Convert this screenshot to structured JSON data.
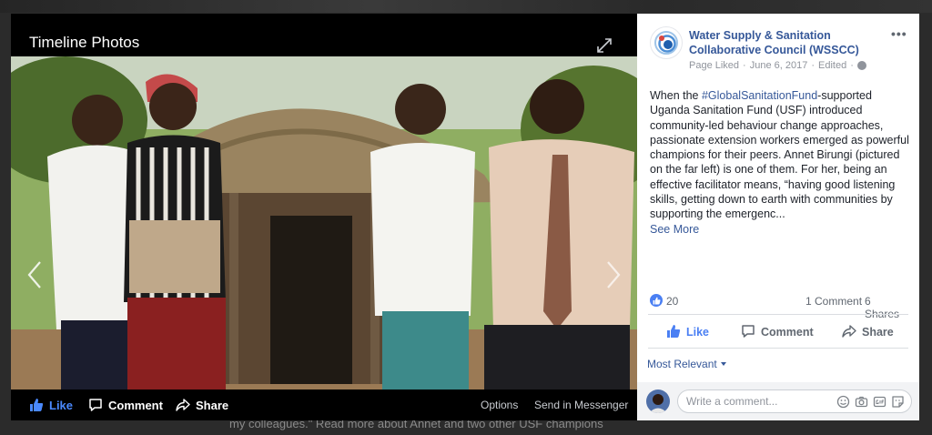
{
  "backdrop": {
    "text": "my colleagues.\" Read more about Annet and two other USF champions"
  },
  "theater": {
    "title": "Timeline Photos",
    "photo_alt": "",
    "actions": {
      "like": "Like",
      "comment": "Comment",
      "share": "Share"
    },
    "links": {
      "options": "Options",
      "messenger": "Send in Messenger"
    }
  },
  "post": {
    "page_name": "Water Supply & Sanitation Collaborative Council (WSSCC)",
    "meta": {
      "liked": "Page Liked",
      "separator1": "·",
      "date": "June 6, 2017",
      "separator2": "·",
      "edited": "Edited",
      "separator3": "·"
    },
    "text_before": "When the ",
    "hashtag": "#GlobalSanitationFund",
    "text_after": "-supported Uganda Sanitation Fund (USF) introduced community-led behaviour change approaches, passionate extension workers emerged as powerful champions for their peers. Annet Birungi (pictured on the far left) is one of them. For her, being an effective facilitator means, “having good listening skills, getting down to earth with communities by supporting the emergenc...",
    "see_more": "See More",
    "reactions": {
      "count": "20",
      "comments": "1 Comment",
      "shares": "6 Shares"
    },
    "actions": {
      "like": "Like",
      "comment": "Comment",
      "share": "Share"
    },
    "sort_label": "Most Relevant",
    "comment_input": {
      "value": "",
      "placeholder": "Write a comment..."
    }
  },
  "colors": {
    "facebook_blue": "#365899",
    "like_blue": "#4a7ff3",
    "theater_like": "#4a89ff"
  },
  "icons": [
    "expand-icon",
    "prev-arrow-icon",
    "next-arrow-icon",
    "thumbs-up-icon",
    "comment-bubble-icon",
    "share-arrow-icon",
    "more-options-icon",
    "globe-icon",
    "emoji-icon",
    "camera-icon",
    "gif-icon",
    "sticker-icon"
  ]
}
